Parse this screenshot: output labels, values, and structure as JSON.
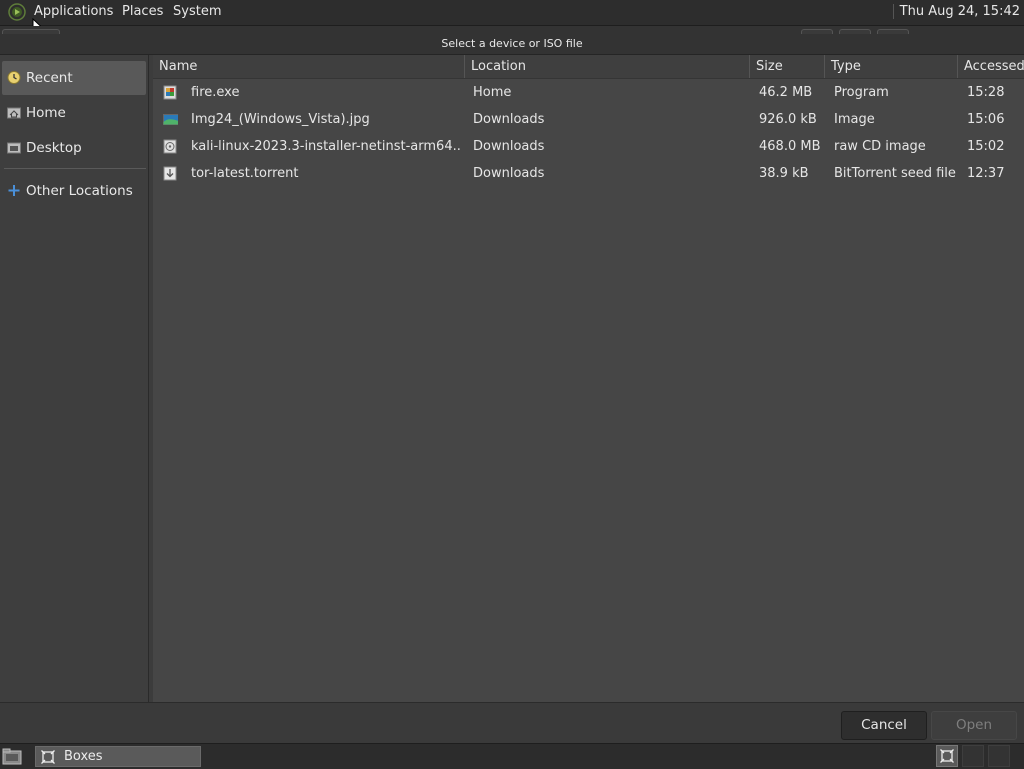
{
  "top_panel": {
    "menus": [
      "Applications",
      "Places",
      "System"
    ],
    "clock": "Thu Aug 24, 15:42"
  },
  "dialog": {
    "title": "Select a device or ISO file"
  },
  "sidebar": {
    "items": [
      {
        "label": "Recent",
        "icon": "recent-icon",
        "active": true
      },
      {
        "label": "Home",
        "icon": "home-folder-icon"
      },
      {
        "label": "Desktop",
        "icon": "desktop-folder-icon"
      },
      {
        "label": "Other Locations",
        "icon": "plus-icon"
      }
    ]
  },
  "columns": [
    "Name",
    "Location",
    "Size",
    "Type",
    "Accessed"
  ],
  "files": [
    {
      "name": "fire.exe",
      "location": "Home",
      "size": "46.2 MB",
      "type": "Program",
      "accessed": "15:28",
      "icon": "executable-icon"
    },
    {
      "name": "Img24_(Windows_Vista).jpg",
      "location": "Downloads",
      "size": "926.0 kB",
      "type": "Image",
      "accessed": "15:06",
      "icon": "image-icon"
    },
    {
      "name": "kali-linux-2023.3-installer-netinst-arm64....",
      "location": "Downloads",
      "size": "468.0 MB",
      "type": "raw CD image",
      "accessed": "15:02",
      "icon": "disc-image-icon"
    },
    {
      "name": "tor-latest.torrent",
      "location": "Downloads",
      "size": "38.9 kB",
      "type": "BitTorrent seed file",
      "accessed": "12:37",
      "icon": "torrent-icon"
    }
  ],
  "buttons": {
    "cancel": "Cancel",
    "open": "Open"
  },
  "taskbar": {
    "window_label": "Boxes"
  }
}
